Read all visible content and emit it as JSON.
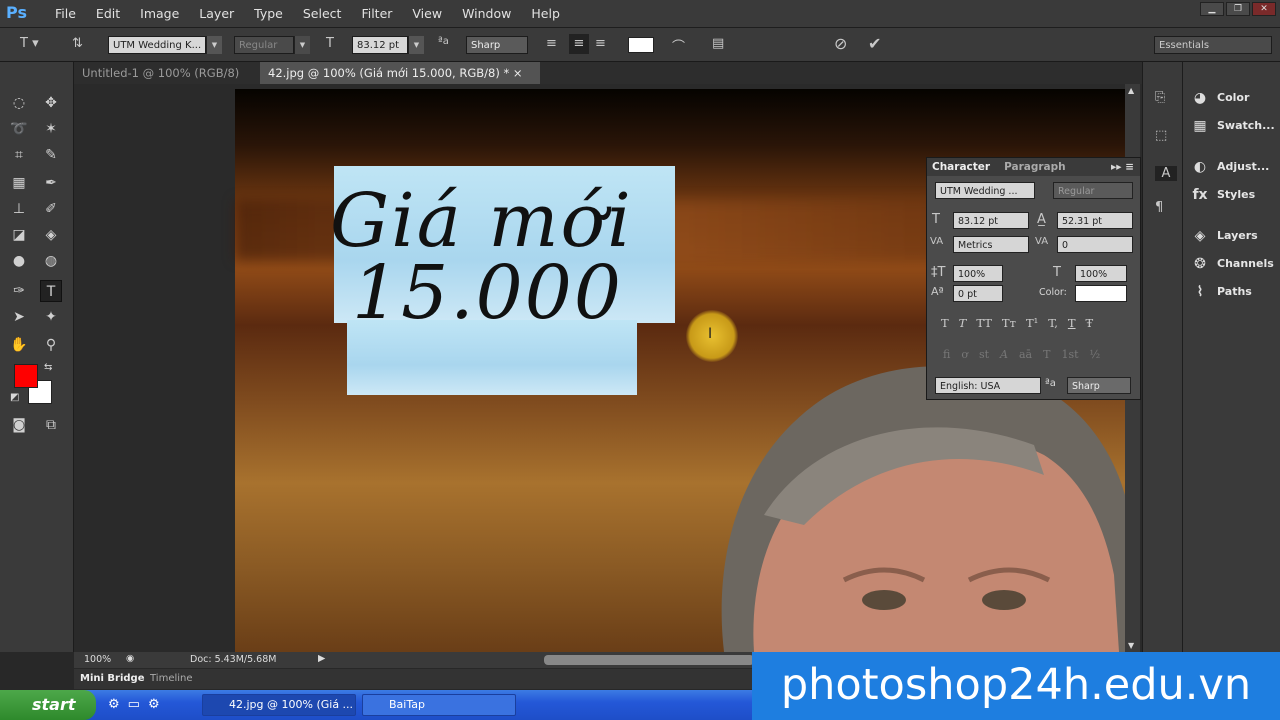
{
  "app": {
    "logo": "Ps",
    "menu": [
      "File",
      "Edit",
      "Image",
      "Layer",
      "Type",
      "Select",
      "Filter",
      "View",
      "Window",
      "Help"
    ]
  },
  "options": {
    "font_family": "UTM Wedding K...",
    "font_style": "Regular",
    "font_size": "83.12 pt",
    "antialias": "Sharp",
    "workspace": "Essentials",
    "text_color": "#ffffff"
  },
  "tabs": [
    {
      "label": "Untitled-1 @ 100% (RGB/8)",
      "close": "×"
    },
    {
      "label": "42.jpg @ 100% (Giá mới 15.000, RGB/8) *",
      "close": "×"
    }
  ],
  "canvas": {
    "text_line1": "Giá mới",
    "text_line2": "15.000"
  },
  "tools": {
    "fg_color": "#ff0000",
    "bg_color": "#ffffff"
  },
  "status": {
    "zoom": "100%",
    "doc": "Doc: 5.43M/5.68M"
  },
  "bottom_tabs": [
    "Mini Bridge",
    "Timeline"
  ],
  "character": {
    "tab1": "Character",
    "tab2": "Paragraph",
    "font": "UTM Wedding ...",
    "style": "Regular",
    "size": "83.12 pt",
    "leading": "52.31 pt",
    "kerning": "Metrics",
    "tracking": "0",
    "vscale": "100%",
    "hscale": "100%",
    "baseline": "0 pt",
    "color_label": "Color:",
    "language": "English: USA",
    "aa": "Sharp",
    "style_buttons": [
      "T",
      "T",
      "TT",
      "Tт",
      "T¹",
      "T,",
      "T",
      "Ŧ"
    ],
    "otf_buttons": [
      "fi",
      "ơ",
      "st",
      "A",
      "aā",
      "T",
      "1st",
      "½"
    ]
  },
  "right_panels": [
    "Color",
    "Swatch...",
    "Adjust...",
    "Styles",
    "Layers",
    "Channels",
    "Paths"
  ],
  "taskbar": {
    "start": "start",
    "items": [
      "42.jpg @ 100% (Giá ...",
      "BaiTap"
    ]
  },
  "watermark": "photoshop24h.edu.vn"
}
